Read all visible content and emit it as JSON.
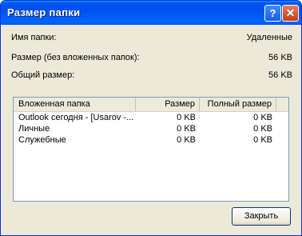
{
  "window": {
    "title": "Размер папки",
    "help_glyph": "?",
    "close_glyph": "✕"
  },
  "info": {
    "folder_name_label": "Имя папки:",
    "folder_name_value": "Удаленные",
    "size_label": "Размер (без вложенных папок):",
    "size_value": "56 KB",
    "total_label": "Общий размер:",
    "total_value": "56 KB"
  },
  "table": {
    "columns": [
      "Вложенная папка",
      "Размер",
      "Полный размер"
    ],
    "rows": [
      [
        "Outlook сегодня - [Usarov -...",
        "0 KB",
        "0 KB"
      ],
      [
        "Личные",
        "0 KB",
        "0 KB"
      ],
      [
        "Служебные",
        "0 KB",
        "0 KB"
      ]
    ]
  },
  "buttons": {
    "close_label": "Закрыть"
  },
  "colors": {
    "title_bar": "#0054e3",
    "dialog_bg": "#ece9d8",
    "list_border": "#7f9db9"
  },
  "icons": {
    "help": "help-icon",
    "close": "close-icon"
  }
}
